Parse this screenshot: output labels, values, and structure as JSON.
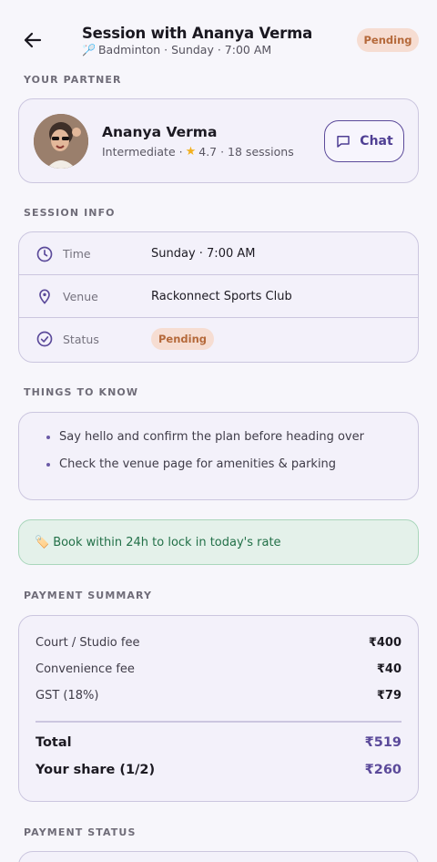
{
  "header": {
    "title": "Session with Ananya Verma",
    "subtitle": "Badminton · Sunday · 7:00 AM",
    "status_badge": "Pending"
  },
  "partner": {
    "section_label": "YOUR PARTNER",
    "name": "Ananya Verma",
    "level": "Intermediate ·",
    "rating": "4.7 · 18 sessions",
    "chat_label": "Chat"
  },
  "session_info": {
    "section_label": "SESSION INFO",
    "rows": [
      {
        "label": "Time",
        "value": "Sunday · 7:00 AM",
        "icon": "clock-icon"
      },
      {
        "label": "Venue",
        "value": "Rackonnect Sports Club",
        "icon": "location-pin-icon"
      },
      {
        "label": "Status",
        "value": "Pending",
        "icon": "check-circle-icon"
      }
    ]
  },
  "things_to_know": {
    "section_label": "THINGS TO KNOW",
    "items": [
      "Say hello and confirm the plan before heading over",
      "Check the venue page for amenities & parking"
    ]
  },
  "tip": {
    "text": "Book within 24h to lock in today's rate",
    "icon": "tag-icon"
  },
  "payment_summary": {
    "section_label": "PAYMENT SUMMARY",
    "items": [
      {
        "label": "Court / Studio fee",
        "amount": "₹400"
      },
      {
        "label": "Convenience fee",
        "amount": "₹40"
      },
      {
        "label": "GST (18%)",
        "amount": "₹79"
      }
    ],
    "total_label": "Total",
    "total_amount": "₹519",
    "share_label": "Your share (1/2)",
    "share_amount": "₹260"
  },
  "payment_status": {
    "section_label": "PAYMENT STATUS"
  },
  "colors": {
    "accent": "#5b4a9a",
    "pending_bg": "#f6ddd2",
    "pending_text": "#b5693a",
    "tip_bg": "#e4f1ea",
    "tip_text": "#227048"
  }
}
